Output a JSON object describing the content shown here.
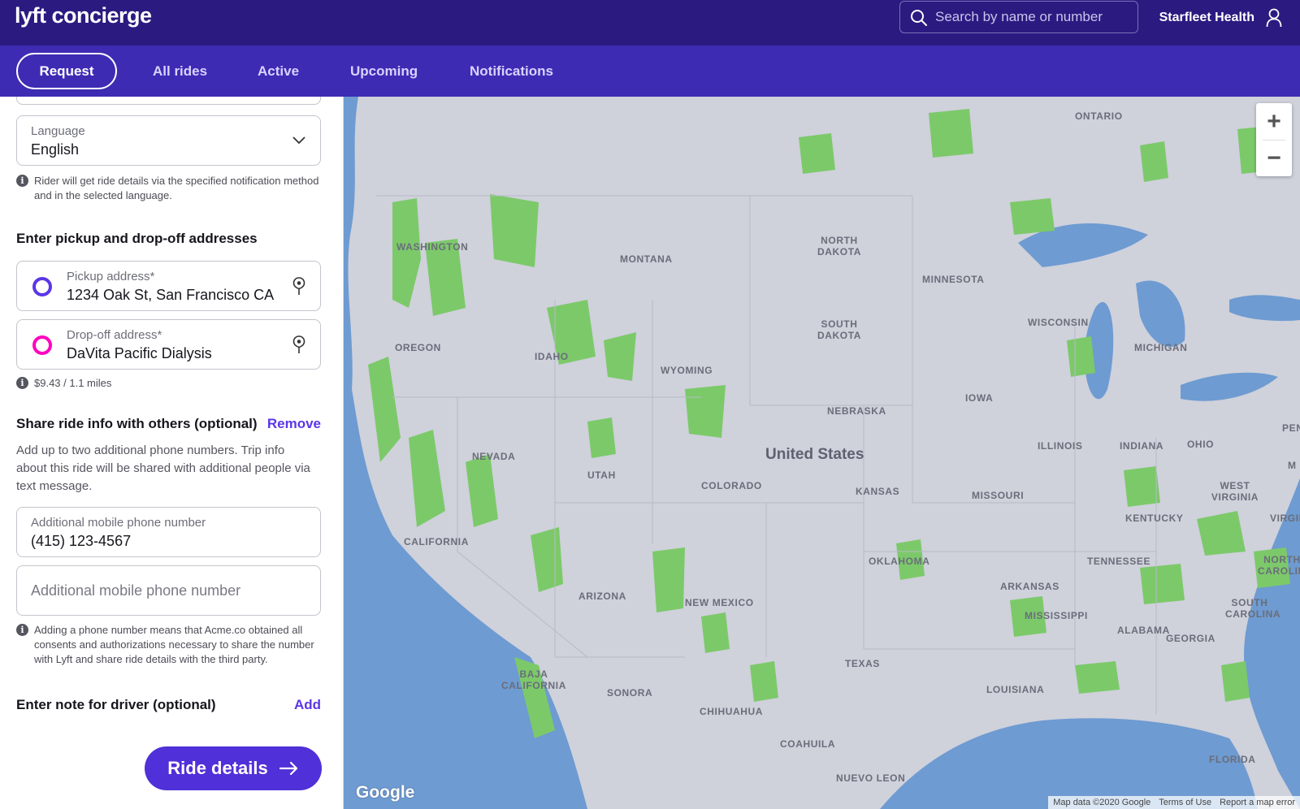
{
  "app": {
    "logo_text": "lyft concierge"
  },
  "header": {
    "search_placeholder": "Search by name or number",
    "account_name": "Starfleet Health"
  },
  "nav": {
    "tabs": [
      {
        "label": "Request",
        "active": true
      },
      {
        "label": "All rides"
      },
      {
        "label": "Active"
      },
      {
        "label": "Upcoming"
      },
      {
        "label": "Notifications"
      }
    ]
  },
  "form": {
    "language": {
      "label": "Language",
      "value": "English"
    },
    "notification_info": "Rider will get ride details via the specified notification method and in the selected language.",
    "addresses_heading": "Enter pickup and drop-off addresses",
    "pickup": {
      "label": "Pickup address*",
      "value": "1234 Oak St, San Francisco CA"
    },
    "dropoff": {
      "label": "Drop-off address*",
      "value": "DaVita Pacific Dialysis"
    },
    "fare_info": "$9.43 / 1.1 miles",
    "share_heading": "Share ride info with others (optional)",
    "share_remove": "Remove",
    "share_description": "Add up to two additional phone numbers. Trip info about this ride will be shared with additional people via text message.",
    "phone1": {
      "label": "Additional mobile phone number",
      "value": "(415) 123-4567"
    },
    "phone2": {
      "placeholder": "Additional mobile phone number"
    },
    "consent_info": "Adding a phone number means that Acme.co obtained all consents and authorizations necessary to share the number with Lyft and share ride details with the third party.",
    "note_heading": "Enter note for driver (optional)",
    "note_add": "Add",
    "cta_label": "Ride details"
  },
  "map": {
    "country_label": "United States",
    "labels": [
      "ONTARIO",
      "WASHINGTON",
      "MONTANA",
      "NORTH DAKOTA",
      "MINNESOTA",
      "SOUTH DAKOTA",
      "WISCONSIN",
      "MICHIGAN",
      "OREGON",
      "IDAHO",
      "WYOMING",
      "IOWA",
      "NEBRASKA",
      "ILLINOIS",
      "INDIANA",
      "OHIO",
      "PENNS",
      "NEVADA",
      "UTAH",
      "COLORADO",
      "KANSAS",
      "MISSOURI",
      "WEST VIRGINIA",
      "KENTUCKY",
      "VIRGINI",
      "CALIFORNIA",
      "OKLAHOMA",
      "TENNESSEE",
      "NORTH CAROLINA",
      "ARIZONA",
      "NEW MEXICO",
      "ARKANSAS",
      "SOUTH CAROLINA",
      "MISSISSIPPI",
      "ALABAMA",
      "GEORGIA",
      "TEXAS",
      "LOUISIANA",
      "BAJA CALIFORNIA",
      "SONORA",
      "CHIHUAHUA",
      "COAHUILA",
      "FLORIDA",
      "NUEVO LEON",
      "M"
    ],
    "zoom_in": "+",
    "zoom_out": "−",
    "google_logo": "Google",
    "attribution": [
      "Map data ©2020 Google",
      "Terms of Use",
      "Report a map error"
    ]
  },
  "colors": {
    "header_bg": "#2b1a80",
    "nav_bg": "#3d2bb4",
    "accent": "#5030d8",
    "pickup_ring": "#5b36e6",
    "dropoff_ring": "#ff00bf",
    "map_land": "#cfd1db",
    "map_water": "#6e9bd1",
    "map_park": "#7cc96a"
  }
}
